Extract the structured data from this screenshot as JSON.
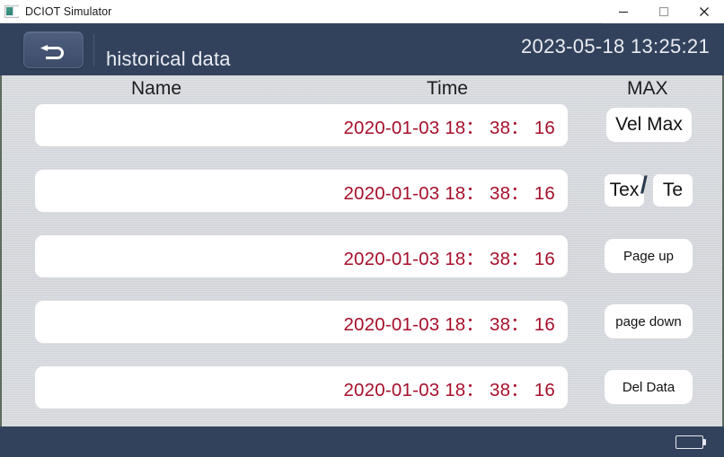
{
  "window": {
    "title": "DCIOT Simulator",
    "icon": "app-icon",
    "controls": {
      "minimize": "minimize-icon",
      "maximize": "maximize-icon",
      "close": "close-icon"
    }
  },
  "header": {
    "back_icon": "back-arrow-icon",
    "screen_title": "historical data",
    "datetime": "2023-05-18 13:25:21",
    "background_color": "#33425c"
  },
  "table": {
    "columns": [
      "Name",
      "Time",
      "MAX"
    ],
    "rows": [
      {
        "name": "",
        "time": "2020-01-03 18： 38： 16"
      },
      {
        "name": "",
        "time": "2020-01-03 18： 38： 16"
      },
      {
        "name": "",
        "time": "2020-01-03 18： 38： 16"
      },
      {
        "name": "",
        "time": "2020-01-03 18： 38： 16"
      },
      {
        "name": "",
        "time": "2020-01-03 18： 38： 16"
      }
    ],
    "time_color": "#a60f2a"
  },
  "actions": {
    "vel_max": "Vel Max",
    "tex": "Tex",
    "te": "Te",
    "separator": "/",
    "page_up": "Page up",
    "page_down": "page down",
    "del_data": "Del Data"
  },
  "footer": {
    "battery_icon": "battery-icon",
    "background_color": "#33425c"
  }
}
